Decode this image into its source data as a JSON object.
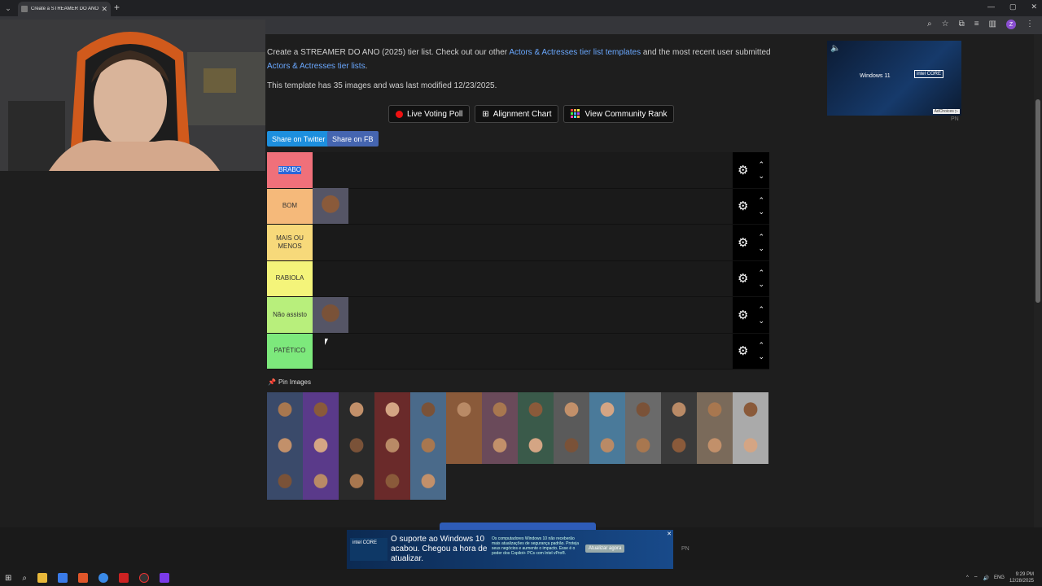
{
  "browser": {
    "tab_title": "Create a STREAMER DO ANO (20",
    "tab_close": "✕",
    "new_tab": "+",
    "win_controls": [
      "—",
      "▢",
      "✕"
    ],
    "avatar_letter": "Z"
  },
  "intro": {
    "text_1": "Create a STREAMER DO ANO (2025) tier list. Check out our other ",
    "link_1": "Actors & Actresses tier list templates",
    "text_2": " and the most recent user submitted ",
    "link_2": "Actors & Actresses tier lists",
    "text_3": ".",
    "meta": "This template has 35 images and was last modified 12/23/2025."
  },
  "buttons": {
    "live_voting": "Live Voting Poll",
    "alignment": "Alignment Chart",
    "community": "View Community Rank",
    "share_twitter": "Share on Twitter",
    "share_fb": "Share on FB"
  },
  "tiers": [
    {
      "label": "BRABO",
      "color": "#f0707a",
      "items": 0,
      "selected": true
    },
    {
      "label": "BOM",
      "color": "#f5b97a",
      "items": 1
    },
    {
      "label": "MAIS OU MENOS",
      "color": "#f7d97a",
      "items": 0
    },
    {
      "label": "RABIOLA",
      "color": "#f4f47a",
      "items": 0
    },
    {
      "label": "Não assisto",
      "color": "#b8ef7c",
      "items": 1
    },
    {
      "label": "PATÉTICO",
      "color": "#7de97c",
      "items": 0
    }
  ],
  "pin_images": "Pin Images",
  "ad_right": {
    "brand": "Windows 11",
    "intel": "intel CORE",
    "choices": "AdChoices ▷",
    "pn": "PN"
  },
  "ad_bottom": {
    "logo": "intel CORE",
    "headline": "O suporte ao Windows 10 acabou. Chegou a hora de atualizar.",
    "small": "Os computadores Windows 10 não receberão mais atualizações de segurança padrão. Proteja seus negócios e aumente o impacto. Esse é o poder dos Copilot+ PCs com Intel vPro®.",
    "cta": "Atualizar agora",
    "pn": "PN"
  },
  "taskbar": {
    "lang": "ENG",
    "time": "9:29 PM",
    "date": "12/28/2025"
  }
}
